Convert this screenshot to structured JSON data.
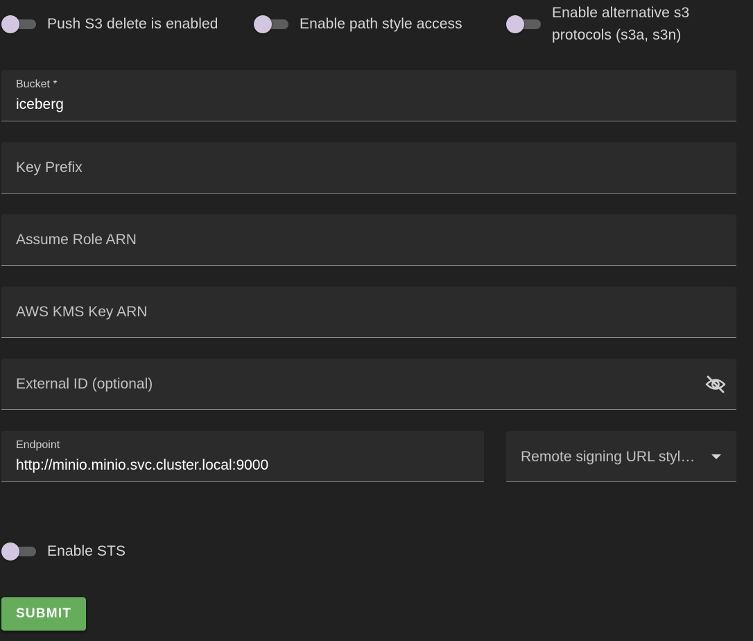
{
  "toggles": {
    "push_s3_delete": {
      "label": "Push S3 delete is enabled",
      "checked": false
    },
    "path_style": {
      "label": "Enable path style access",
      "checked": false
    },
    "alt_protocols": {
      "label_line1": "Enable alternative s3",
      "label_line2": "protocols (s3a, s3n)",
      "checked": false
    },
    "sts": {
      "label": "Enable STS",
      "checked": false
    }
  },
  "fields": {
    "bucket": {
      "label": "Bucket *",
      "value": "iceberg"
    },
    "key_prefix": {
      "placeholder": "Key Prefix"
    },
    "assume_role_arn": {
      "placeholder": "Assume Role ARN"
    },
    "kms_key_arn": {
      "placeholder": "AWS KMS Key ARN"
    },
    "external_id": {
      "placeholder": "External ID (optional)",
      "icon": "eye-off-icon"
    },
    "endpoint": {
      "label": "Endpoint",
      "value": "http://minio.minio.svc.cluster.local:9000"
    },
    "remote_signing": {
      "placeholder": "Remote signing URL styl…",
      "icon": "chevron-down-icon"
    }
  },
  "submit": {
    "label": "SUBMIT"
  },
  "colors": {
    "background": "#212121",
    "field_bg": "#2b2b2b",
    "accent_green": "#66ad5b",
    "switch_thumb": "#d2c6e0",
    "switch_track": "#5d5d5d"
  }
}
